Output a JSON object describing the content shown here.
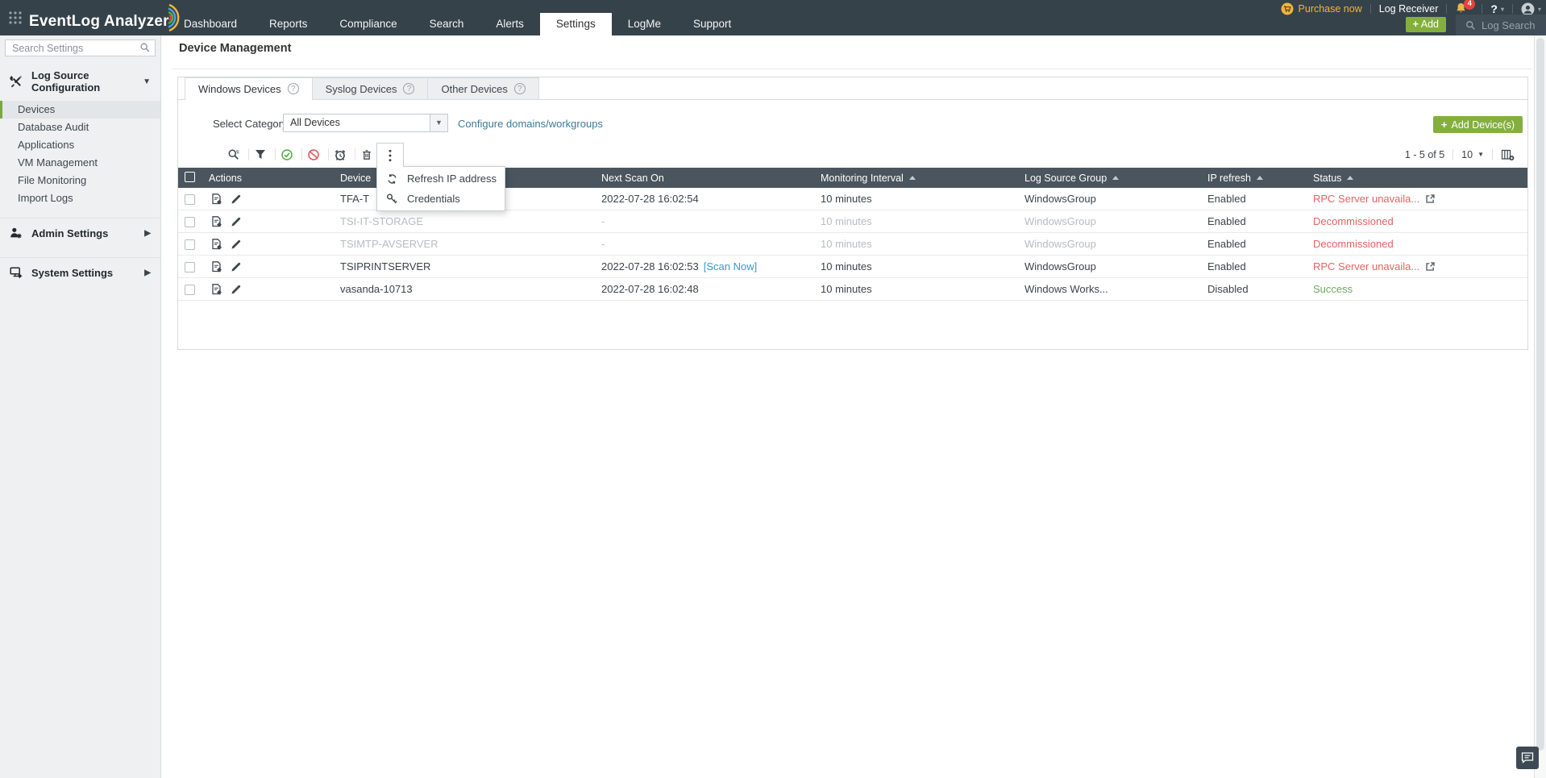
{
  "header": {
    "logo_text": "EventLog Analyzer",
    "nav": [
      {
        "label": "Dashboard",
        "active": false
      },
      {
        "label": "Reports",
        "active": false
      },
      {
        "label": "Compliance",
        "active": false
      },
      {
        "label": "Search",
        "active": false
      },
      {
        "label": "Alerts",
        "active": false
      },
      {
        "label": "Settings",
        "active": true
      },
      {
        "label": "LogMe",
        "active": false
      },
      {
        "label": "Support",
        "active": false
      }
    ],
    "purchase_now": "Purchase now",
    "log_receiver": "Log Receiver",
    "notification_count": "4",
    "help_label": "?",
    "add_button_label": "Add",
    "add_button_plus": "+",
    "log_search_placeholder": "Log Search"
  },
  "sidebar": {
    "search_placeholder": "Search Settings",
    "log_source_section": {
      "label": "Log Source Configuration",
      "expanded": true,
      "items": [
        "Devices",
        "Database Audit",
        "Applications",
        "VM Management",
        "File Monitoring",
        "Import Logs"
      ],
      "selected_item": "Devices"
    },
    "other_sections": [
      {
        "label": "Admin Settings"
      },
      {
        "label": "System Settings"
      }
    ]
  },
  "main": {
    "title": "Device Management",
    "tabs": [
      {
        "label": "Windows Devices",
        "active": true
      },
      {
        "label": "Syslog Devices",
        "active": false
      },
      {
        "label": "Other Devices",
        "active": false
      }
    ],
    "select_category_label": "Select Category",
    "category_value": "All Devices",
    "configure_link": "Configure domains/workgroups",
    "add_device_button": "Add Device(s)",
    "toolbar_icons": [
      "search",
      "filter",
      "enable",
      "disable",
      "schedule",
      "delete"
    ],
    "more_menu": {
      "items": [
        {
          "label": "Refresh IP address",
          "icon": "refresh-icon"
        },
        {
          "label": "Credentials",
          "icon": "key-icon"
        }
      ]
    },
    "pagination": {
      "range": "1 - 5 of 5",
      "page_size": "10"
    },
    "table": {
      "columns": [
        {
          "label": "Actions",
          "sortable": false
        },
        {
          "label": "Device",
          "sortable": false
        },
        {
          "label": "Next Scan On",
          "sortable": false
        },
        {
          "label": "Monitoring Interval",
          "sortable": true
        },
        {
          "label": "Log Source Group",
          "sortable": true
        },
        {
          "label": "IP refresh",
          "sortable": true
        },
        {
          "label": "Status",
          "sortable": true
        }
      ],
      "rows": [
        {
          "device": "TFA-T",
          "next_scan": "2022-07-28 16:02:54",
          "scan_now": "",
          "interval": "10 minutes",
          "group": "WindowsGroup",
          "ip_refresh": "Enabled",
          "status": "RPC Server unavaila...",
          "status_type": "error",
          "external_link": true,
          "dimmed": false
        },
        {
          "device": "TSI-IT-STORAGE",
          "next_scan": "-",
          "scan_now": "",
          "interval": "10 minutes",
          "group": "WindowsGroup",
          "ip_refresh": "Enabled",
          "status": "Decommissioned",
          "status_type": "error",
          "external_link": false,
          "dimmed": true
        },
        {
          "device": "TSIMTP-AVSERVER",
          "next_scan": "-",
          "scan_now": "",
          "interval": "10 minutes",
          "group": "WindowsGroup",
          "ip_refresh": "Enabled",
          "status": "Decommissioned",
          "status_type": "error",
          "external_link": false,
          "dimmed": true
        },
        {
          "device": "TSIPRINTSERVER",
          "next_scan": "2022-07-28 16:02:53",
          "scan_now": "[Scan Now]",
          "interval": "10 minutes",
          "group": "WindowsGroup",
          "ip_refresh": "Enabled",
          "status": "RPC Server unavaila...",
          "status_type": "error",
          "external_link": true,
          "dimmed": false
        },
        {
          "device": "vasanda-10713",
          "next_scan": "2022-07-28 16:02:48",
          "scan_now": "",
          "interval": "10 minutes",
          "group": "Windows Works...",
          "ip_refresh": "Disabled",
          "status": "Success",
          "status_type": "success",
          "external_link": false,
          "dimmed": false
        }
      ]
    }
  },
  "colors": {
    "header_bg": "#36424a",
    "accent_green": "#84af3d",
    "selected_green_bar": "#79a93e",
    "orange": "#f2b33d",
    "badge_red": "#e8413c",
    "table_header_bg": "#4a555e",
    "status_error": "#e06463",
    "status_success": "#67ad5b",
    "link_blue": "#3a98cc",
    "link_teal": "#3d7a99"
  }
}
